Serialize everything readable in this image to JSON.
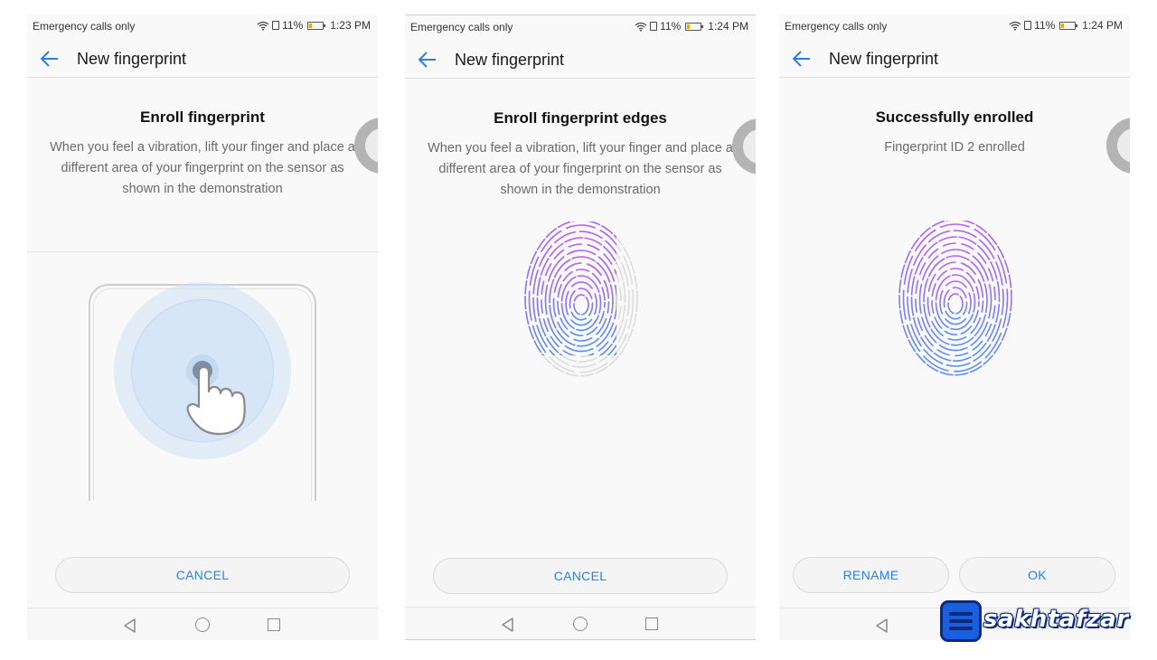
{
  "colors": {
    "accent": "#2c7fe0",
    "fingerprint_top": "#b85ff0",
    "fingerprint_bottom": "#5b8ff6",
    "battery": "#f0a400"
  },
  "screens": [
    {
      "status": {
        "carrier": "Emergency calls only",
        "battery": "11%",
        "time": "1:23 PM"
      },
      "title": "New fingerprint",
      "heading": "Enroll fingerprint",
      "description": "When you feel a vibration, lift your finger and place a different area of your fingerprint on the sensor as shown in the demonstration",
      "buttons": [
        "CANCEL"
      ]
    },
    {
      "status": {
        "carrier": "Emergency calls only",
        "battery": "11%",
        "time": "1:24 PM"
      },
      "title": "New fingerprint",
      "heading": "Enroll fingerprint edges",
      "description": "When you feel a vibration, lift your finger and place a different area of your fingerprint on the sensor as shown in the demonstration",
      "buttons": [
        "CANCEL"
      ]
    },
    {
      "status": {
        "carrier": "Emergency calls only",
        "battery": "11%",
        "time": "1:24 PM"
      },
      "title": "New fingerprint",
      "heading": "Successfully enrolled",
      "description": "Fingerprint ID 2 enrolled",
      "buttons": [
        "RENAME",
        "OK"
      ]
    }
  ],
  "watermark": {
    "text": "sakhtafzar"
  },
  "icons": [
    "wifi-icon",
    "sim-icon",
    "battery-icon",
    "back-arrow-icon",
    "nav-back-icon",
    "nav-home-icon",
    "nav-recent-icon",
    "fingerprint-icon",
    "touch-hand-icon"
  ]
}
